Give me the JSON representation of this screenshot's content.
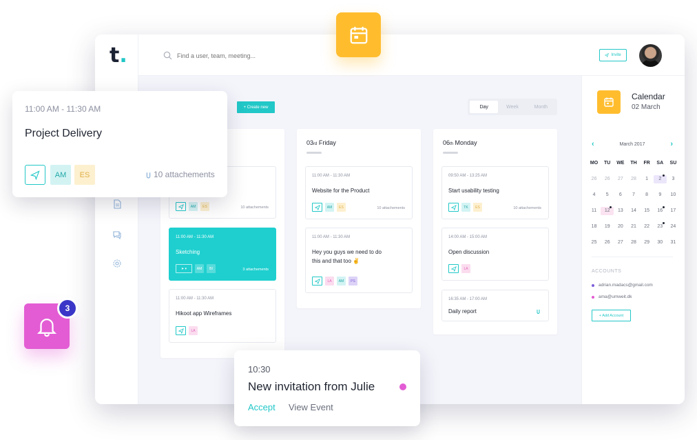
{
  "app": {
    "logo": "t",
    "logo_dot": "."
  },
  "topbar": {
    "search_placeholder": "Find a user, team, meeting...",
    "invite_label": "Invite"
  },
  "toolbar": {
    "create_label": "+ Create new",
    "views": [
      "Day",
      "Week",
      "Month"
    ],
    "active_view": "Day"
  },
  "columns": [
    {
      "day": "",
      "suffix": "",
      "weekday": "",
      "cards": [
        {
          "time": "",
          "title": "",
          "tags": [
            "AM",
            "ES"
          ],
          "attachments": "10 attachements",
          "highlight": false
        },
        {
          "time": "11:00 AM - 11:30 AM",
          "title": "Sketching",
          "tags": [
            "AM",
            "BI"
          ],
          "attachments": "3 attachements",
          "highlight": true
        },
        {
          "time": "11:00 AM - 11:30 AM",
          "title": "Hikoot app Wireframes",
          "tags": [
            "LA"
          ],
          "attachments": "",
          "highlight": false
        }
      ]
    },
    {
      "day": "03",
      "suffix": "rd",
      "weekday": "Friday",
      "cards": [
        {
          "time": "11:00 AM - 11:30 AM",
          "title": "Website for the Product",
          "tags": [
            "AM",
            "ES"
          ],
          "attachments": "10 attachements"
        },
        {
          "time": "11:00 AM - 11:30 AM",
          "title": "Hey you guys we need to do this and that too ✌",
          "tags": [
            "LA",
            "AM",
            "PS"
          ],
          "attachments": ""
        }
      ]
    },
    {
      "day": "06",
      "suffix": "th",
      "weekday": "Monday",
      "cards": [
        {
          "time": "09:50 AM - 13:25 AM",
          "title": "Start usability testing",
          "tags": [
            "TK",
            "ES"
          ],
          "attachments": "10 attachements"
        },
        {
          "time": "14:00 AM - 15:00 AM",
          "title": "Open discussion",
          "tags": [
            "LA"
          ],
          "attachments": ""
        },
        {
          "time": "16:35 AM - 17:00 AM",
          "title": "Daily report",
          "tags": [],
          "attachments": ""
        }
      ]
    }
  ],
  "right_panel": {
    "title": "Calendar",
    "subtitle": "02 March",
    "month": "March 2017",
    "weekdays": [
      "MO",
      "TU",
      "WE",
      "TH",
      "FR",
      "SA",
      "SU"
    ],
    "weeks": [
      [
        "26",
        "26",
        "27",
        "28",
        "1",
        "2",
        "3"
      ],
      [
        "4",
        "5",
        "6",
        "7",
        "8",
        "9",
        "10"
      ],
      [
        "11",
        "12",
        "13",
        "14",
        "15",
        "16",
        "17"
      ],
      [
        "18",
        "19",
        "20",
        "21",
        "22",
        "23",
        "24"
      ],
      [
        "25",
        "26",
        "27",
        "28",
        "29",
        "30",
        "31"
      ]
    ],
    "accounts_label": "ACCOUNTS",
    "accounts": [
      {
        "email": "adrian.madacs@gmail.com",
        "color": "#7e5ed8"
      },
      {
        "email": "ama@umweit.dk",
        "color": "#e35cd4"
      }
    ],
    "add_account_label": "+ Add Account"
  },
  "float_card": {
    "time": "11:00 AM - 11:30 AM",
    "title": "Project Delivery",
    "tags": [
      "AM",
      "ES"
    ],
    "attachments": "10 attachements"
  },
  "notification": {
    "count": "3"
  },
  "invite_card": {
    "time": "10:30",
    "title": "New invitation from Julie",
    "accept": "Accept",
    "view": "View Event"
  },
  "colors": {
    "accent": "#22c7c7",
    "yellow": "#ffbd2e",
    "pink": "#e35cd4",
    "indigo": "#3b36c8"
  }
}
